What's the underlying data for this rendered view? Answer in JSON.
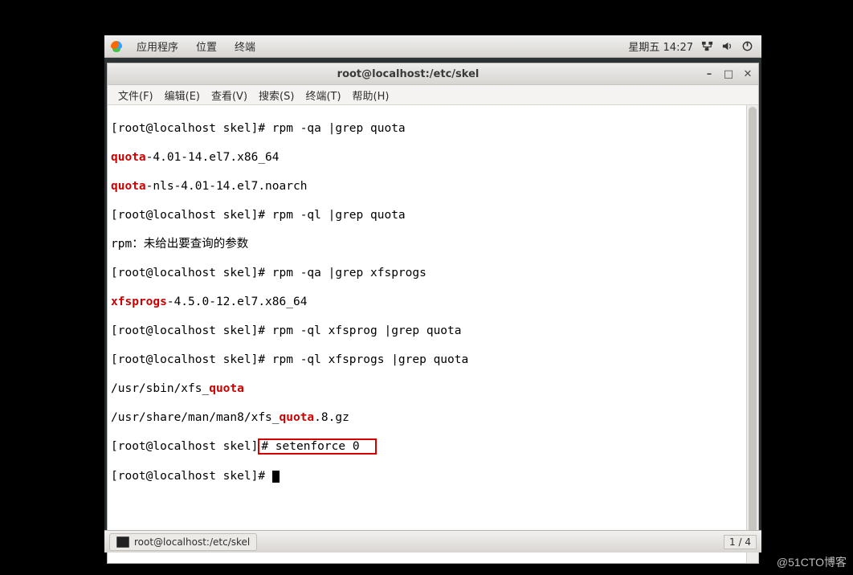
{
  "panel": {
    "apps": "应用程序",
    "places": "位置",
    "terminal": "终端",
    "clock": "星期五 14:27"
  },
  "window": {
    "title": "root@localhost:/etc/skel"
  },
  "menubar": {
    "file": "文件(F)",
    "edit": "编辑(E)",
    "view": "查看(V)",
    "search": "搜索(S)",
    "terminal": "终端(T)",
    "help": "帮助(H)"
  },
  "term": {
    "l1a": "[root@localhost skel]# rpm -qa |grep quota",
    "l2a": "quota",
    "l2b": "-4.01-14.el7.x86_64",
    "l3a": "quota",
    "l3b": "-nls-4.01-14.el7.noarch",
    "l4a": "[root@localhost skel]# rpm -ql |grep quota",
    "l5a": "rpm：未给出要查询的参数",
    "l6a": "[root@localhost skel]# rpm -qa |grep xfsprogs",
    "l7a": "xfsprogs",
    "l7b": "-4.5.0-12.el7.x86_64",
    "l8a": "[root@localhost skel]# rpm -ql xfsprog |grep quota",
    "l9a": "[root@localhost skel]# rpm -ql xfsprogs |grep quota",
    "l10a": "/usr/sbin/xfs_",
    "l10b": "quota",
    "l11a": "/usr/share/man/man8/xfs_",
    "l11b": "quota",
    "l11c": ".8.gz",
    "l12a": "[root@localhost skel]",
    "l12b": "# setenforce 0  ",
    "l13a": "[root@localhost skel]# "
  },
  "taskbar": {
    "item1": "root@localhost:/etc/skel",
    "pager": "1 / 4"
  },
  "watermark": "@51CTO博客"
}
